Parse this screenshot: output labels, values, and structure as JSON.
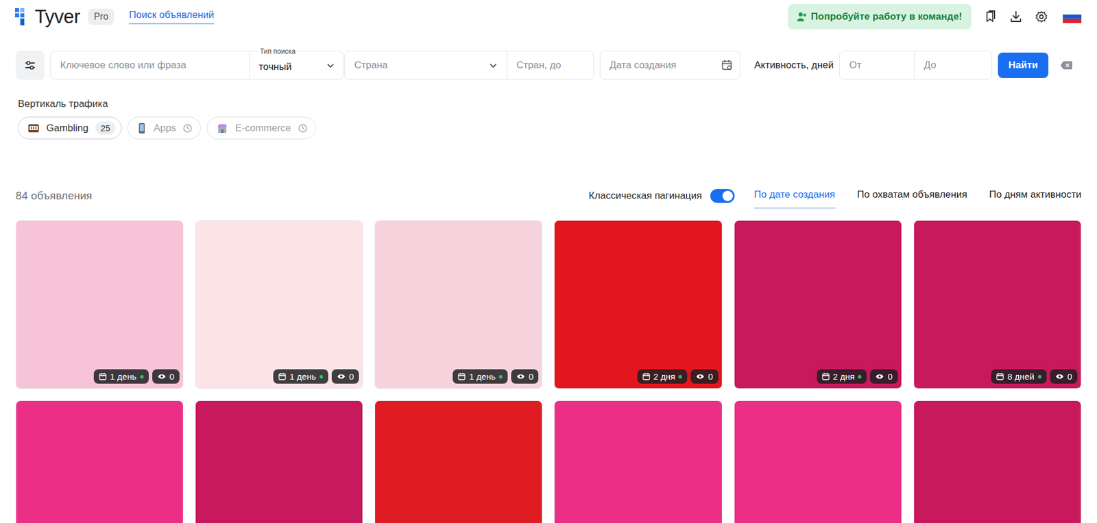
{
  "header": {
    "logo": "Tyver",
    "plan": "Pro",
    "nav": [
      {
        "label": "Поиск объявлений",
        "selected": true
      }
    ],
    "team_button": "Попробуйте работу в команде!"
  },
  "search": {
    "keyword_placeholder": "Ключевое слово или фраза",
    "type_label": "Тип поиска",
    "type_value": "точный",
    "country_placeholder": "Страна",
    "countries_to_placeholder": "Стран, до",
    "date_placeholder": "Дата создания",
    "activity_label": "Активность, дней",
    "from_placeholder": "От",
    "to_placeholder": "До",
    "submit": "Найти"
  },
  "verticals": {
    "title": "Вертикаль трафика",
    "items": [
      {
        "label": "Gambling",
        "count": "25",
        "available": true,
        "selected": true
      },
      {
        "label": "Apps",
        "available": false,
        "selected": false
      },
      {
        "label": "E-commerce",
        "available": false,
        "selected": false
      }
    ]
  },
  "results": {
    "count": "84 объявления",
    "pagination_label": "Классическая пагинация",
    "pagination_on": true,
    "sorts": [
      {
        "label": "По дате создания",
        "selected": true
      },
      {
        "label": "По охватам объявления",
        "selected": false
      },
      {
        "label": "По дням активности",
        "selected": false
      }
    ]
  },
  "cards": [
    {
      "color": "#f7c3d6",
      "days": "1 день",
      "views": "0"
    },
    {
      "color": "#fbe3e6",
      "days": "1 день",
      "views": "0"
    },
    {
      "color": "#f6d3dc",
      "days": "1 день",
      "views": "0"
    },
    {
      "color": "#e3161f",
      "days": "2 дня",
      "views": "0"
    },
    {
      "color": "#c7195c",
      "days": "2 дня",
      "views": "0"
    },
    {
      "color": "#c7195c",
      "days": "8 дней",
      "views": "0"
    },
    {
      "color": "#ec2f86"
    },
    {
      "color": "#c7195c"
    },
    {
      "color": "#e01b24"
    },
    {
      "color": "#ec2f86"
    },
    {
      "color": "#ec2f86"
    },
    {
      "color": "#c7195c"
    }
  ]
}
